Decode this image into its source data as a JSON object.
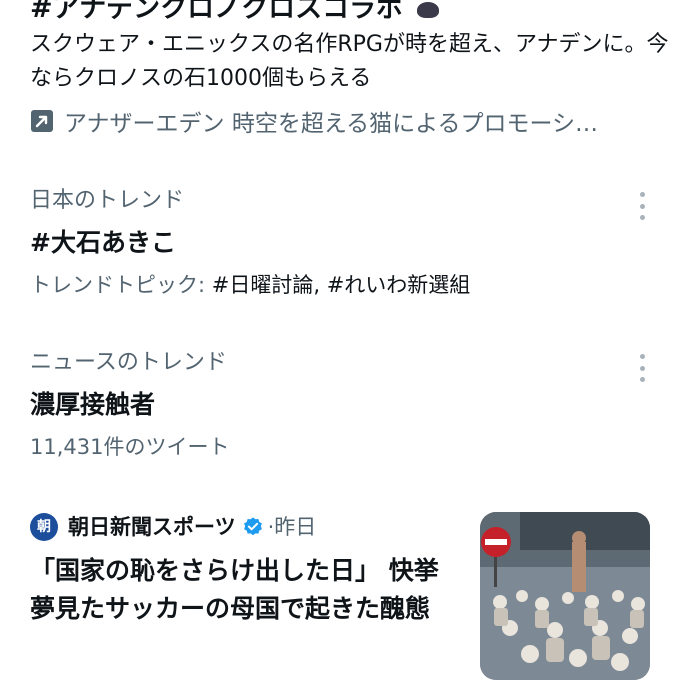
{
  "promo": {
    "title": "#アナデンクロノクロスコラボ",
    "emoji_icon": "cat-emoji-icon",
    "description": "スクウェア・エニックスの名作RPGが時を超え、アナデンに。今ならクロノスの石1000個もらえる",
    "promoted_icon": "promoted-arrow-icon",
    "promoted_text": "アナザーエデン 時空を超える猫によるプロモーシ…"
  },
  "trends": [
    {
      "context": "日本のトレンド",
      "name": "#大石あきこ",
      "meta_label": "トレンドトピック: ",
      "meta_value": "#日曜討論, #れいわ新選組"
    },
    {
      "context": "ニュースのトレンド",
      "name": "濃厚接触者",
      "meta_label": "11,431件のツイート",
      "meta_value": ""
    }
  ],
  "news": {
    "avatar_text": "朝",
    "source": "朝日新聞スポーツ",
    "verified_icon": "verified-badge-icon",
    "separator": "·",
    "time": "昨日",
    "headline": "「国家の恥をさらけ出した日」 快挙夢見たサッカーの母国で起きた醜態",
    "thumbnail": "news-thumbnail-image"
  },
  "colors": {
    "text": "#0f1419",
    "secondary": "#536471",
    "verified": "#1d9bf0",
    "avatar": "#1c4e9c"
  }
}
